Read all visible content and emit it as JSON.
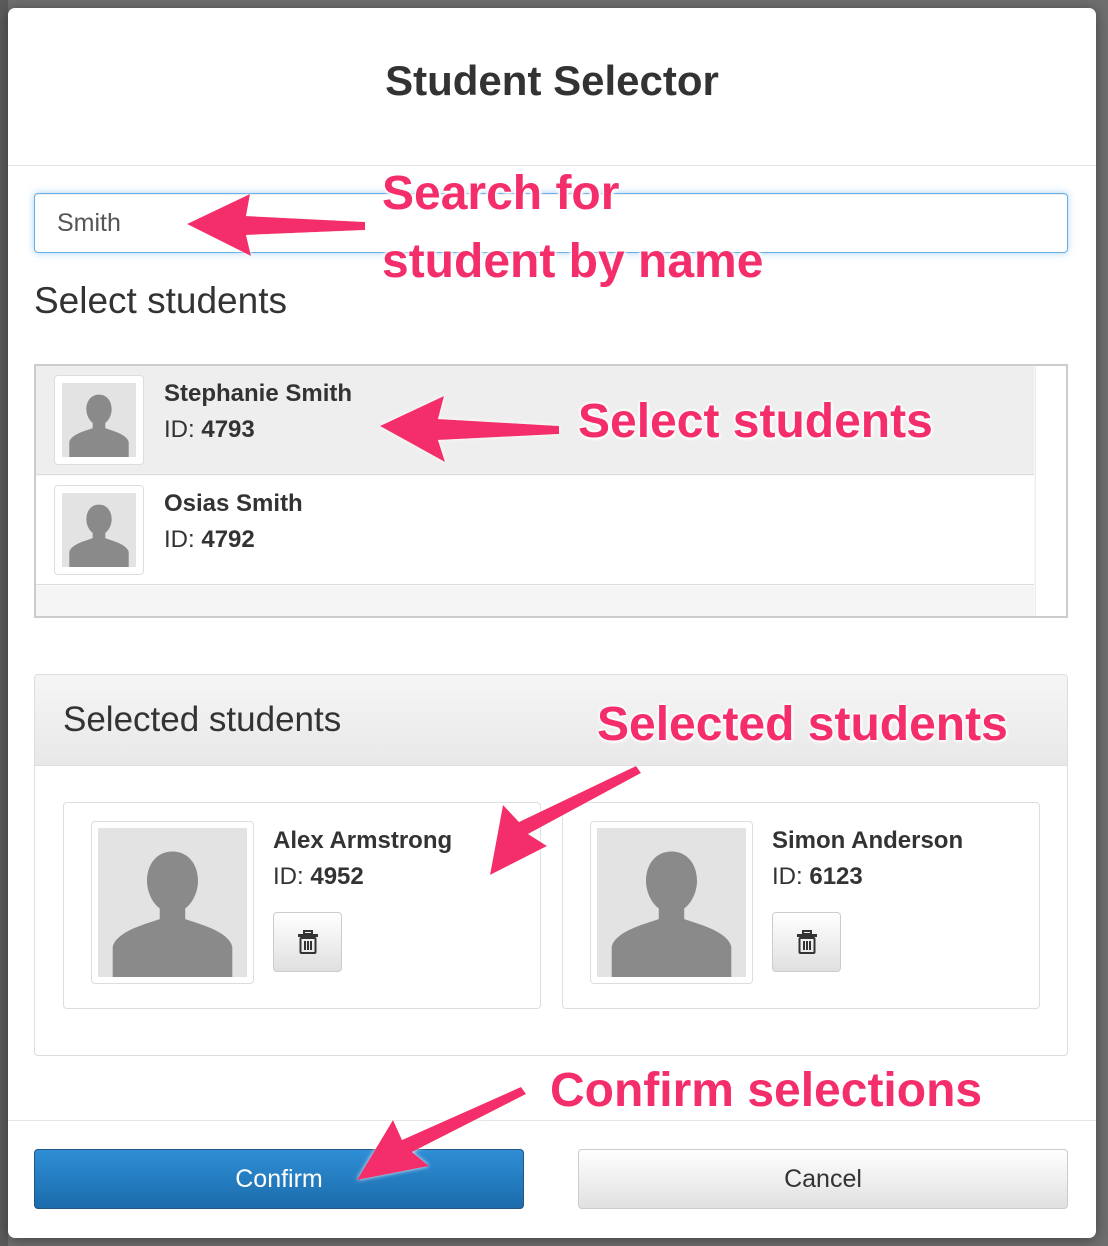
{
  "dialog": {
    "title": "Student Selector"
  },
  "search": {
    "value": "Smith",
    "placeholder": ""
  },
  "select_section": {
    "label": "Select students"
  },
  "results": [
    {
      "name": "Stephanie Smith",
      "id_label": "ID: ",
      "id": "4793",
      "state": "hover"
    },
    {
      "name": "Osias Smith",
      "id_label": "ID: ",
      "id": "4792",
      "state": "normal"
    }
  ],
  "selected_section": {
    "label": "Selected students"
  },
  "selected": [
    {
      "name": "Alex Armstrong",
      "id_label": "ID: ",
      "id": "4952",
      "remove_icon": "trash-icon"
    },
    {
      "name": "Simon Anderson",
      "id_label": "ID: ",
      "id": "6123",
      "remove_icon": "trash-icon"
    }
  ],
  "footer": {
    "confirm_label": "Confirm",
    "cancel_label": "Cancel"
  },
  "annotations": {
    "search_line1": "Search for",
    "search_line2": "student by name",
    "select": "Select students",
    "selected": "Selected students",
    "confirm": "Confirm selections"
  },
  "colors": {
    "annotation": "#f42d6b",
    "confirm_button": "#1f77bf",
    "focus_ring": "#66afe9"
  },
  "icons": {
    "avatar": "user-silhouette-icon",
    "remove": "trash-icon"
  }
}
